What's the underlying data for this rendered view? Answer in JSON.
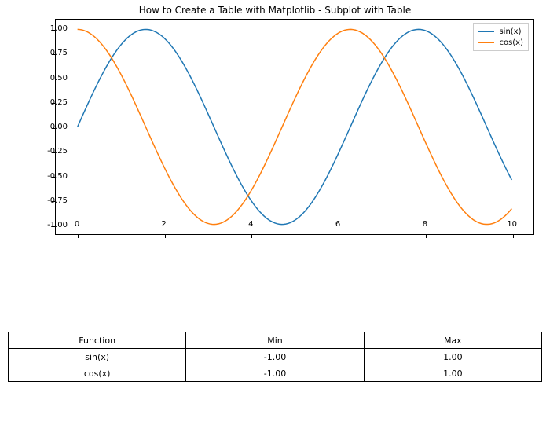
{
  "chart_data": {
    "type": "line",
    "title": "How to Create a Table with Matplotlib - Subplot with Table",
    "x_range": [
      -0.5,
      10.5
    ],
    "y_range": [
      -1.1,
      1.1
    ],
    "x_ticks": [
      0,
      2,
      4,
      6,
      8,
      10
    ],
    "y_ticks": [
      -1.0,
      -0.75,
      -0.5,
      -0.25,
      0.0,
      0.25,
      0.5,
      0.75,
      1.0
    ],
    "x_tick_labels": [
      "0",
      "2",
      "4",
      "6",
      "8",
      "10"
    ],
    "y_tick_labels": [
      "-1.00",
      "-0.75",
      "-0.50",
      "-0.25",
      "0.00",
      "0.25",
      "0.50",
      "0.75",
      "1.00"
    ],
    "series": [
      {
        "name": "sin(x)",
        "color": "#1f77b4",
        "x": [
          0,
          0.5,
          1,
          1.5,
          2,
          2.5,
          3,
          3.5,
          4,
          4.5,
          5,
          5.5,
          6,
          6.5,
          7,
          7.5,
          8,
          8.5,
          9,
          9.5,
          10
        ],
        "y": [
          0.0,
          0.479,
          0.841,
          0.997,
          0.909,
          0.599,
          0.141,
          -0.351,
          -0.757,
          -0.978,
          -0.959,
          -0.706,
          -0.279,
          0.215,
          0.657,
          0.938,
          0.989,
          0.798,
          0.412,
          -0.075,
          -0.544
        ]
      },
      {
        "name": "cos(x)",
        "color": "#ff7f0e",
        "x": [
          0,
          0.5,
          1,
          1.5,
          2,
          2.5,
          3,
          3.5,
          4,
          4.5,
          5,
          5.5,
          6,
          6.5,
          7,
          7.5,
          8,
          8.5,
          9,
          9.5,
          10
        ],
        "y": [
          1.0,
          0.878,
          0.54,
          0.071,
          -0.416,
          -0.801,
          -0.99,
          -0.936,
          -0.654,
          -0.211,
          0.284,
          0.709,
          0.96,
          0.977,
          0.754,
          0.347,
          -0.146,
          -0.602,
          -0.911,
          -0.997,
          -0.839
        ]
      }
    ],
    "legend": {
      "items": [
        "sin(x)",
        "cos(x)"
      ],
      "position": "upper right"
    }
  },
  "table": {
    "headers": [
      "Function",
      "Min",
      "Max"
    ],
    "rows": [
      [
        "sin(x)",
        "-1.00",
        "1.00"
      ],
      [
        "cos(x)",
        "-1.00",
        "1.00"
      ]
    ]
  }
}
